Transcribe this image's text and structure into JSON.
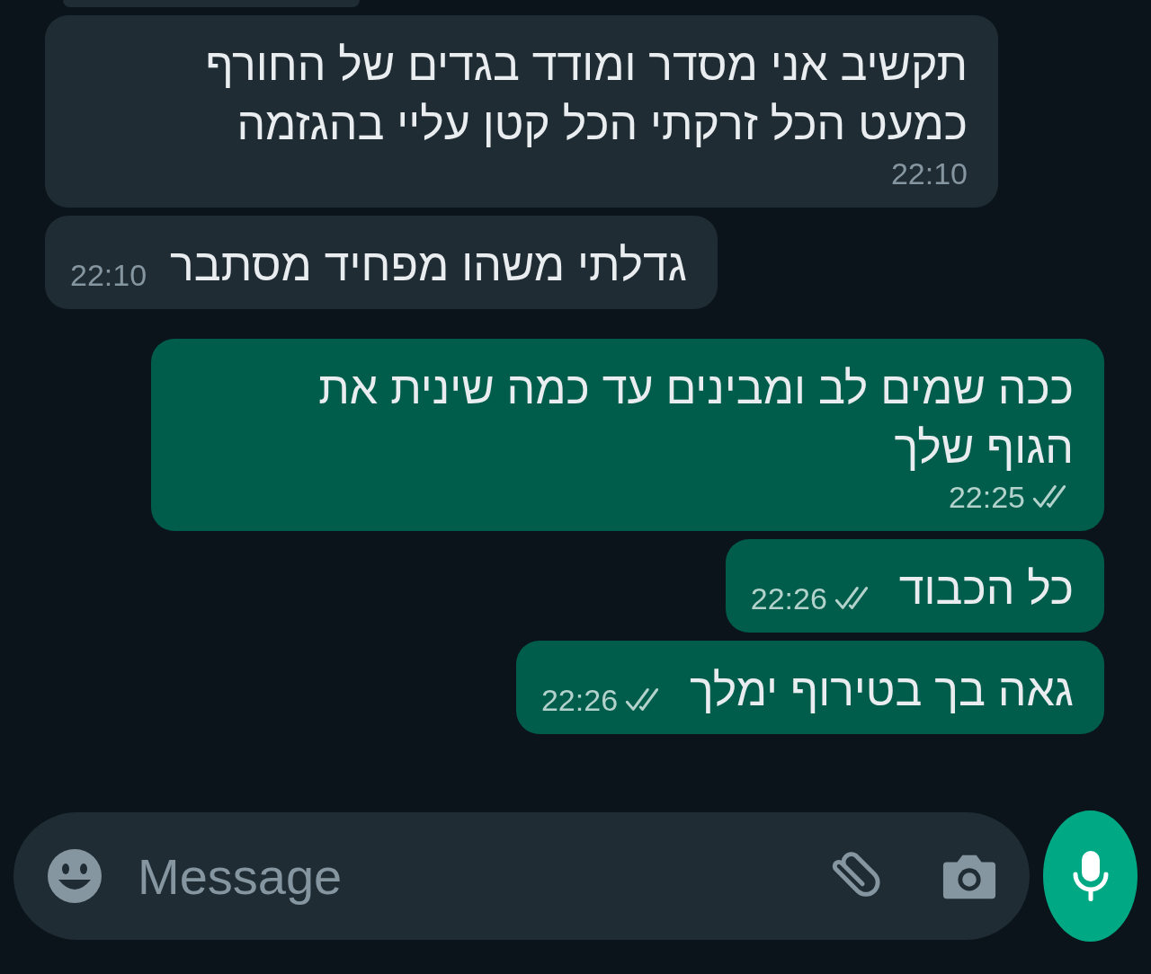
{
  "messages": [
    {
      "kind": "partial"
    },
    {
      "kind": "incoming",
      "text": "תקשיב אני מסדר ומודד בגדים של החורף כמעט הכל זרקתי הכל קטן עליי בהגזמה",
      "time": "22:10"
    },
    {
      "kind": "incoming",
      "text": "גדלתי משהו מפחיד מסתבר",
      "time": "22:10"
    },
    {
      "kind": "outgoing",
      "text": "ככה שמים לב ומבינים עד כמה שינית את הגוף שלך",
      "time": "22:25",
      "read": false
    },
    {
      "kind": "outgoing",
      "text": "כל הכבוד",
      "time": "22:26",
      "read": false
    },
    {
      "kind": "outgoing",
      "text": "גאה בך בטירוף ימלך",
      "time": "22:26",
      "read": false
    }
  ],
  "composer": {
    "placeholder": "Message"
  }
}
